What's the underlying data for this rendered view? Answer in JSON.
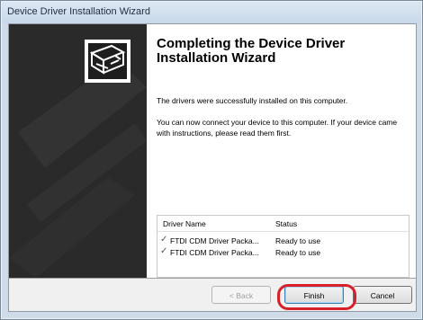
{
  "window": {
    "title": "Device Driver Installation Wizard"
  },
  "main": {
    "heading": "Completing the Device Driver Installation Wizard",
    "paragraph1": "The drivers were successfully installed on this computer.",
    "paragraph2": "You can now connect your device to this computer. If your device came with instructions, please read them first."
  },
  "table": {
    "headers": [
      "Driver Name",
      "Status"
    ],
    "rows": [
      {
        "name": "FTDI CDM Driver Packa...",
        "status": "Ready to use"
      },
      {
        "name": "FTDI CDM Driver Packa...",
        "status": "Ready to use"
      }
    ]
  },
  "buttons": {
    "back": "< Back",
    "finish": "Finish",
    "cancel": "Cancel"
  },
  "icons": {
    "check": "checkmark-icon",
    "wizard": "driver-box-icon"
  }
}
